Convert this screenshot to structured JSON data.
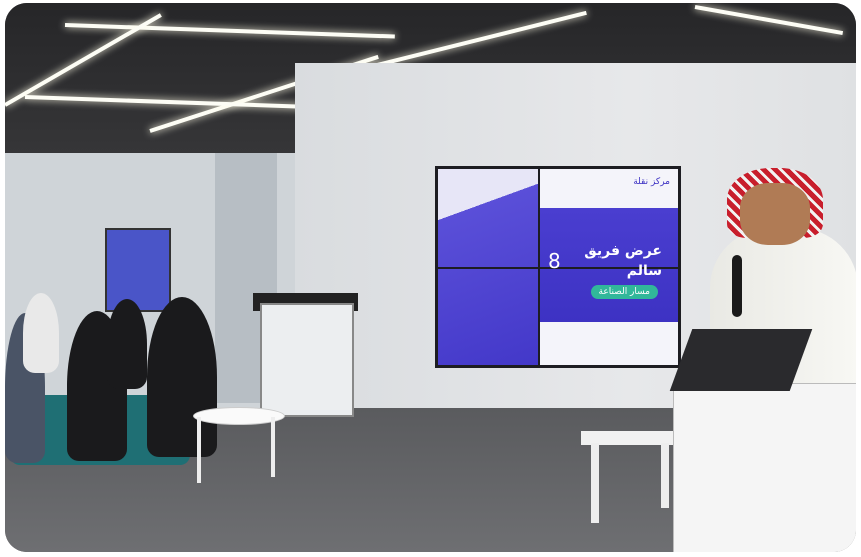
{
  "scene": {
    "description_free": true
  },
  "slide": {
    "number": "8",
    "title_line1": "عرض فريق",
    "title_line2": "سالم",
    "track": "مسار الصناعة",
    "brand": "مركز نقلة"
  },
  "colors": {
    "slide_purple": "#4338c9",
    "slide_accent": "#31b79a",
    "ghutra_red": "#c81e2c"
  }
}
